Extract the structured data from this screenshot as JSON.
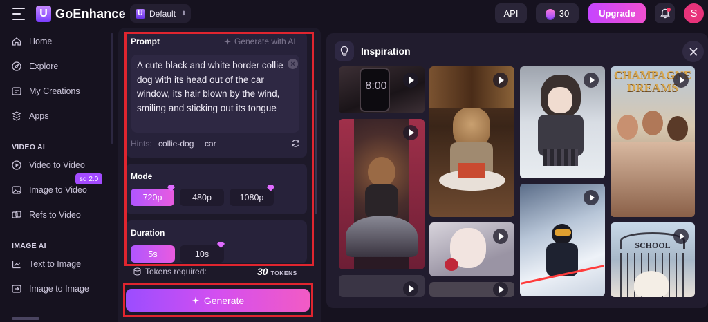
{
  "app": {
    "name": "GoEnhance",
    "logo_letter": "U",
    "workspace": "Default",
    "workspace_letter": "U"
  },
  "topbar": {
    "api_label": "API",
    "credits": "30",
    "upgrade_label": "Upgrade",
    "avatar_letter": "S"
  },
  "sidebar": {
    "items": [
      {
        "label": "Home",
        "icon": "home-icon"
      },
      {
        "label": "Explore",
        "icon": "compass-icon"
      },
      {
        "label": "My Creations",
        "icon": "folder-icon"
      },
      {
        "label": "Apps",
        "icon": "apps-icon"
      }
    ],
    "video_section": "VIDEO AI",
    "video_items": [
      {
        "label": "Video to Video",
        "icon": "video-icon"
      },
      {
        "label": "Image to Video",
        "icon": "image-video-icon"
      },
      {
        "label": "Refs to Video",
        "icon": "refs-icon",
        "badge": "sd 2.0"
      }
    ],
    "image_section": "IMAGE AI",
    "image_items": [
      {
        "label": "Text to Image",
        "icon": "text-image-icon"
      },
      {
        "label": "Image to Image",
        "icon": "image-image-icon"
      }
    ]
  },
  "form": {
    "prompt_label": "Prompt",
    "generate_ai_label": "Generate with AI",
    "prompt_text": "A cute black and white border collie dog with its head out of the car window, its hair blown by the wind, smiling and sticking out its tongue",
    "hints_label": "Hints:",
    "hints": [
      "collie-dog",
      "car"
    ],
    "mode_label": "Mode",
    "modes": [
      {
        "label": "720p",
        "active": true,
        "premium": true
      },
      {
        "label": "480p",
        "active": false,
        "premium": false
      },
      {
        "label": "1080p",
        "active": false,
        "premium": true
      }
    ],
    "duration_label": "Duration",
    "durations": [
      {
        "label": "5s",
        "active": true,
        "premium": false
      },
      {
        "label": "10s",
        "active": false,
        "premium": true
      }
    ],
    "tokens_label": "Tokens required:",
    "tokens_value": "30",
    "tokens_unit": "TOKENS",
    "generate_label": "Generate"
  },
  "inspiration": {
    "title": "Inspiration",
    "tiles": [
      {
        "name": "phone-clock",
        "text": "8:00"
      },
      {
        "name": "teddy-drummer",
        "text": ""
      },
      {
        "name": "yorkie-cake",
        "text": ""
      },
      {
        "name": "anime-girl-ice",
        "text": ""
      },
      {
        "name": "champagne-dreams",
        "text": "CHAMPAGNE DREAMS"
      },
      {
        "name": "anime-girl-apple",
        "text": ""
      },
      {
        "name": "skier",
        "text": ""
      },
      {
        "name": "school-puppy",
        "text": "SCHOOL"
      },
      {
        "name": "dark-tile-1",
        "text": ""
      },
      {
        "name": "dark-tile-2",
        "text": ""
      }
    ]
  },
  "colors": {
    "accent": "#b056ff",
    "accent_pink": "#f04fd0",
    "highlight_red": "#e0252f"
  }
}
